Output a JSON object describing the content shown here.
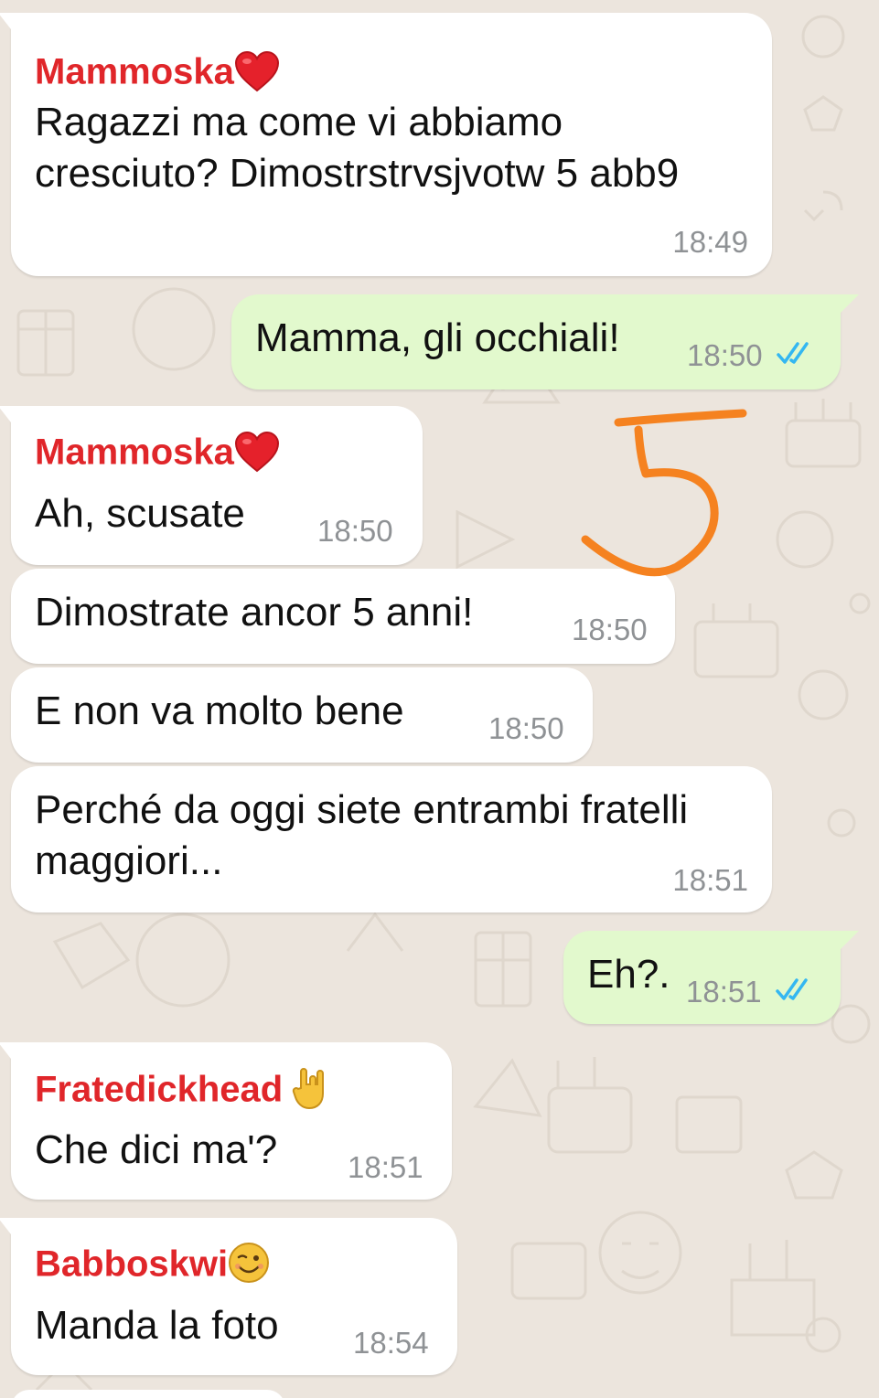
{
  "colors": {
    "background": "#ece5dd",
    "incoming_bubble": "#ffffff",
    "outgoing_bubble": "#e2f9cd",
    "sender_name": "#e0262a",
    "timestamp": "#8f9295",
    "read_ticks": "#34b7f1",
    "annotation_stroke": "#f58220"
  },
  "messages": [
    {
      "direction": "incoming",
      "sender": "Mammoska",
      "sender_icon": "red-heart-icon",
      "text": "Ragazzi ma come vi abbiamo\ncresciuto? Dimostrstrvsjvotw 5 abb9",
      "time": "18:49"
    },
    {
      "direction": "outgoing",
      "text": "Mamma, gli occhiali!",
      "time": "18:50",
      "status_icon": "double-check-read-icon"
    },
    {
      "direction": "incoming",
      "sender": "Mammoska",
      "sender_icon": "red-heart-icon",
      "text": "Ah, scusate",
      "time": "18:50"
    },
    {
      "direction": "incoming",
      "text": "Dimostrate ancor 5 anni!",
      "time": "18:50"
    },
    {
      "direction": "incoming",
      "text": "E non va molto bene",
      "time": "18:50"
    },
    {
      "direction": "incoming",
      "text": "Perché da oggi siete entrambi fratelli\nmaggiori...",
      "time": "18:51"
    },
    {
      "direction": "outgoing",
      "text": "Eh?.",
      "time": "18:51",
      "status_icon": "double-check-read-icon"
    },
    {
      "direction": "incoming",
      "sender": "Fratedickhead",
      "sender_icon": "rock-hand-icon",
      "text": "Che dici ma'?",
      "time": "18:51"
    },
    {
      "direction": "incoming",
      "sender": "Babboskwi",
      "sender_icon": "winking-face-icon",
      "text": "Manda la foto",
      "time": "18:54"
    }
  ],
  "annotation": {
    "icon": "handwritten-five-annotation"
  }
}
